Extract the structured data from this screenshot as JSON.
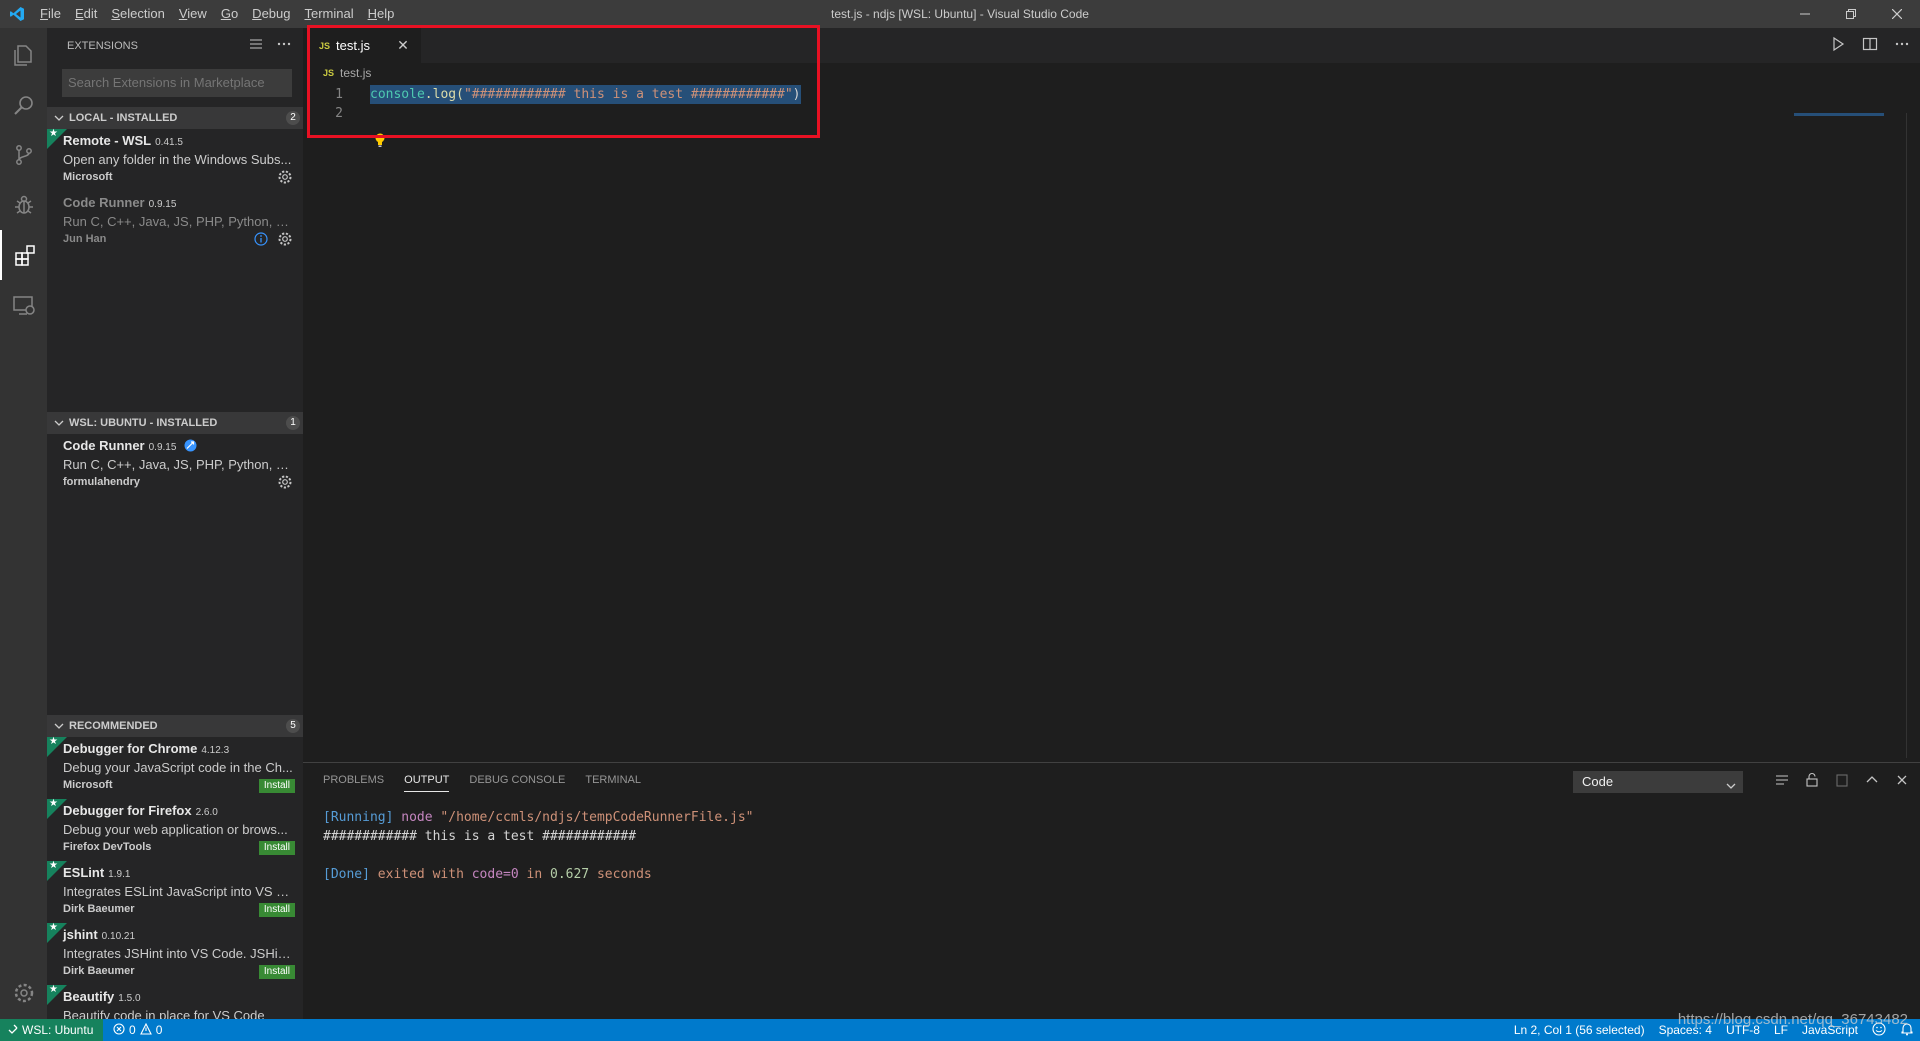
{
  "window": {
    "title": "test.js - ndjs [WSL: Ubuntu] - Visual Studio Code",
    "menu": [
      "File",
      "Edit",
      "Selection",
      "View",
      "Go",
      "Debug",
      "Terminal",
      "Help"
    ]
  },
  "sidebar": {
    "title": "EXTENSIONS",
    "search_placeholder": "Search Extensions in Marketplace",
    "sections": [
      {
        "title": "LOCAL - INSTALLED",
        "count": "2",
        "items": [
          {
            "name": "Remote - WSL",
            "version": "0.41.5",
            "description": "Open any folder in the Windows Subs...",
            "publisher": "Microsoft"
          },
          {
            "name": "Code Runner",
            "version": "0.9.15",
            "description": "Run C, C++, Java, JS, PHP, Python, Perl...",
            "publisher": "Jun Han"
          }
        ]
      },
      {
        "title": "WSL: UBUNTU - INSTALLED",
        "count": "1",
        "items": [
          {
            "name": "Code Runner",
            "version": "0.9.15",
            "description": "Run C, C++, Java, JS, PHP, Python, Perl...",
            "publisher": "formulahendry"
          }
        ]
      },
      {
        "title": "RECOMMENDED",
        "count": "5",
        "install_label": "Install",
        "items": [
          {
            "name": "Debugger for Chrome",
            "version": "4.12.3",
            "description": "Debug your JavaScript code in the Ch...",
            "publisher": "Microsoft"
          },
          {
            "name": "Debugger for Firefox",
            "version": "2.6.0",
            "description": "Debug your web application or brows...",
            "publisher": "Firefox DevTools"
          },
          {
            "name": "ESLint",
            "version": "1.9.1",
            "description": "Integrates ESLint JavaScript into VS C...",
            "publisher": "Dirk Baeumer"
          },
          {
            "name": "jshint",
            "version": "0.10.21",
            "description": "Integrates JSHint into VS Code. JSHint...",
            "publisher": "Dirk Baeumer"
          },
          {
            "name": "Beautify",
            "version": "1.5.0",
            "description": "Beautify code in place for VS Code",
            "publisher": ""
          }
        ]
      }
    ]
  },
  "editor": {
    "tab_label": "test.js",
    "tab_badge": "JS",
    "breadcrumb": "test.js",
    "lines": [
      {
        "number": "1",
        "fn": "console",
        "method": ".log(",
        "string": "\"############ this is a test ############\"",
        "close": ")"
      },
      {
        "number": "2"
      }
    ]
  },
  "panel": {
    "tabs": [
      "PROBLEMS",
      "OUTPUT",
      "DEBUG CONSOLE",
      "TERMINAL"
    ],
    "active_tab": "OUTPUT",
    "channel": "Code",
    "output": {
      "running_tag": "[Running]",
      "running_cmd": "node",
      "running_path": "\"/home/ccmls/ndjs/tempCodeRunnerFile.js\"",
      "printed": "############ this is a test ############",
      "done_tag": "[Done]",
      "done_exited": "exited with",
      "done_code_var": "code",
      "done_code_eq": "=0",
      "done_in": "in",
      "done_time": "0.627",
      "done_seconds": "seconds"
    }
  },
  "statusbar": {
    "remote": "WSL: Ubuntu",
    "errors": "0",
    "warnings": "0",
    "position": "Ln 2, Col 1 (56 selected)",
    "spaces": "Spaces: 4",
    "encoding": "UTF-8",
    "eol": "LF",
    "language": "JavaScript",
    "watermark": "https://blog.csdn.net/qq_36743482"
  },
  "colors": {
    "accent": "#007acc",
    "highlight_box": "#e81123",
    "remote": "#16825d",
    "install": "#388a34"
  }
}
